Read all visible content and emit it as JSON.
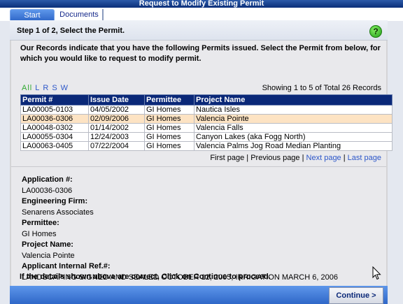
{
  "window": {
    "title": "Request to Modify Existing Permit"
  },
  "tabs": [
    {
      "label": "Start"
    },
    {
      "label": "Documents"
    }
  ],
  "header": {
    "step": "Step 1 of 2, Select the Permit."
  },
  "intro": "Our Records indicate that you have the following Permits issued. Select the Permit from below, for which you would like to request to modify permit.",
  "filter_letters": [
    "All",
    "L",
    "R",
    "S",
    "W"
  ],
  "showing": "Showing 1 to 5 of Total 26 Records",
  "table": {
    "headers": [
      "Permit #",
      "Issue Date",
      "Permittee",
      "Project Name"
    ],
    "rows": [
      [
        "LA00005-0103",
        "04/05/2002",
        "GI Homes",
        "Nautica Isles"
      ],
      [
        "LA00036-0306",
        "02/09/2006",
        "GI Homes",
        "Valencia Pointe"
      ],
      [
        "LA00048-0302",
        "01/14/2002",
        "GI Homes",
        "Valencia Falls"
      ],
      [
        "LA00055-0304",
        "12/24/2003",
        "GI Homes",
        "Canyon Lakes (aka Fogg North)"
      ],
      [
        "LA00063-0405",
        "07/22/2004",
        "GI Homes",
        "Valencia Palms Jog Road Median Planting"
      ]
    ]
  },
  "pager": {
    "first": "First page",
    "previous": "Previous page",
    "next": "Next page",
    "last": "Last page"
  },
  "details": {
    "application_label": "Application #:",
    "application_value": "LA00036-0306",
    "engineering_label": "Engineering Firm:",
    "engineering_value": "Senarens Associates",
    "permittee_label": "Permittee:",
    "permittee_value": "GI Homes",
    "project_label": "Project Name:",
    "project_value": "Valencia Pointe",
    "ref_label": "Applicant Internal Ref.#:",
    "ref_value": "LANDSCAPING SIGNED AND SEALED OCTOBER 12, 2005, IRRIGATION MARCH 6, 2006"
  },
  "confirm_text": "If the details shown above are correct, Click on Continue to proceed.",
  "continue_label": "Continue  >"
}
